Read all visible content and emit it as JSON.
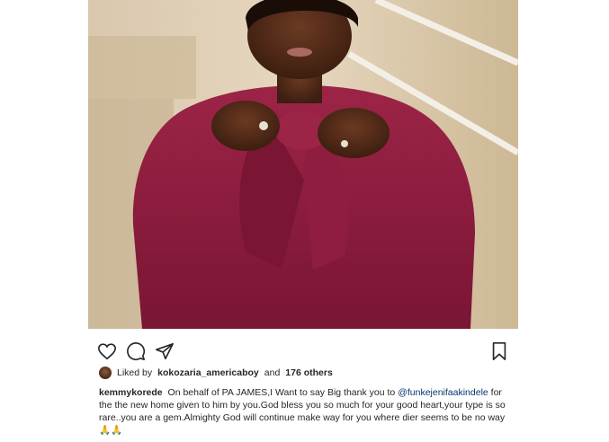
{
  "post": {
    "liked_prefix": "Liked by",
    "liked_by_user": "kokozaria_americaboy",
    "liked_and": "and",
    "liked_others": "176 others",
    "caption_user": "kemmykorede",
    "caption_part1": "On behalf of PA JAMES,I Want to say Big thank you to",
    "caption_mention": "@funkejenifaakindele",
    "caption_part2": "for the the new home given to him by you.God bless you so much for your good heart,your type is so rare..you are a gem.Almighty God will continue make way for you where dier seems to be no way",
    "caption_emoji": "🙏🙏"
  },
  "icons": {
    "like": "heart-icon",
    "comment": "comment-icon",
    "share": "share-icon",
    "save": "bookmark-icon"
  },
  "colors": {
    "dress": "#8a1a3c",
    "mention": "#00376b",
    "text": "#262626"
  }
}
